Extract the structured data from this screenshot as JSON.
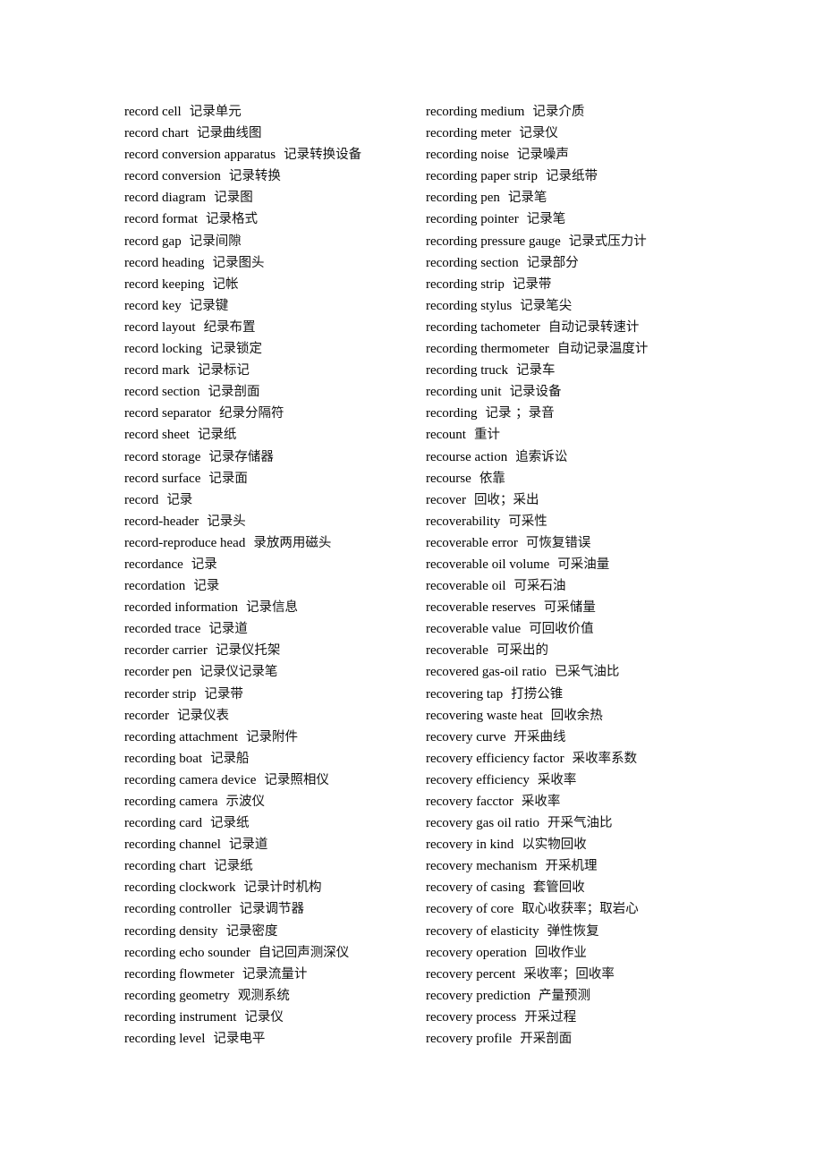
{
  "document": {
    "left_column": [
      {
        "en": "record cell",
        "zh": "记录单元"
      },
      {
        "en": "record chart",
        "zh": "记录曲线图"
      },
      {
        "en": "record conversion apparatus",
        "zh": "记录转换设备"
      },
      {
        "en": "record conversion",
        "zh": "记录转换"
      },
      {
        "en": "record diagram",
        "zh": "记录图"
      },
      {
        "en": "record format",
        "zh": "记录格式"
      },
      {
        "en": "record gap",
        "zh": "记录间隙"
      },
      {
        "en": "record heading",
        "zh": "记录图头"
      },
      {
        "en": "record keeping",
        "zh": "记帐"
      },
      {
        "en": "record key",
        "zh": "记录键"
      },
      {
        "en": "record layout",
        "zh": "纪录布置"
      },
      {
        "en": "record locking",
        "zh": "记录锁定"
      },
      {
        "en": "record mark",
        "zh": "记录标记"
      },
      {
        "en": "record section",
        "zh": "记录剖面"
      },
      {
        "en": "record separator",
        "zh": "纪录分隔符"
      },
      {
        "en": "record sheet",
        "zh": "记录纸"
      },
      {
        "en": "record storage",
        "zh": "记录存储器"
      },
      {
        "en": "record surface",
        "zh": "记录面"
      },
      {
        "en": "record",
        "zh": "记录"
      },
      {
        "en": "record-header",
        "zh": "记录头"
      },
      {
        "en": "record-reproduce head",
        "zh": "录放两用磁头"
      },
      {
        "en": "recordance",
        "zh": "记录"
      },
      {
        "en": "recordation",
        "zh": "记录"
      },
      {
        "en": "recorded information",
        "zh": "记录信息"
      },
      {
        "en": "recorded trace",
        "zh": "记录道"
      },
      {
        "en": "recorder carrier",
        "zh": "记录仪托架"
      },
      {
        "en": "recorder pen",
        "zh": "记录仪记录笔"
      },
      {
        "en": "recorder strip",
        "zh": "记录带"
      },
      {
        "en": "recorder",
        "zh": "记录仪表"
      },
      {
        "en": "recording attachment",
        "zh": "记录附件"
      },
      {
        "en": "recording boat",
        "zh": "记录船"
      },
      {
        "en": "recording camera device",
        "zh": "记录照相仪"
      },
      {
        "en": "recording camera",
        "zh": "示波仪"
      },
      {
        "en": "recording card",
        "zh": "记录纸"
      },
      {
        "en": "recording channel",
        "zh": "记录道"
      },
      {
        "en": "recording chart",
        "zh": "记录纸"
      },
      {
        "en": "recording clockwork",
        "zh": "记录计时机构"
      },
      {
        "en": "recording controller",
        "zh": "记录调节器"
      },
      {
        "en": "recording density",
        "zh": "记录密度"
      },
      {
        "en": "recording echo sounder",
        "zh": "自记回声测深仪"
      },
      {
        "en": "recording flowmeter",
        "zh": "记录流量计"
      },
      {
        "en": "recording geometry",
        "zh": "观测系统"
      },
      {
        "en": "recording instrument",
        "zh": "记录仪"
      },
      {
        "en": "recording level",
        "zh": "记录电平"
      }
    ],
    "right_column": [
      {
        "en": "recording medium",
        "zh": "记录介质"
      },
      {
        "en": "recording meter",
        "zh": "记录仪"
      },
      {
        "en": "recording noise",
        "zh": "记录噪声"
      },
      {
        "en": "recording paper strip",
        "zh": "记录纸带"
      },
      {
        "en": "recording pen",
        "zh": "记录笔"
      },
      {
        "en": "recording pointer",
        "zh": "记录笔"
      },
      {
        "en": "recording pressure gauge",
        "zh": "记录式压力计"
      },
      {
        "en": "recording section",
        "zh": "记录部分"
      },
      {
        "en": "recording strip",
        "zh": "记录带"
      },
      {
        "en": "recording stylus",
        "zh": "记录笔尖"
      },
      {
        "en": "recording tachometer",
        "zh": "自动记录转速计"
      },
      {
        "en": "recording thermometer",
        "zh": "自动记录温度计"
      },
      {
        "en": "recording truck",
        "zh": "记录车"
      },
      {
        "en": "recording unit",
        "zh": "记录设备"
      },
      {
        "en": "recording",
        "zh": "记录 ；录音"
      },
      {
        "en": "recount",
        "zh": "重计"
      },
      {
        "en": "recourse action",
        "zh": "追索诉讼"
      },
      {
        "en": "recourse",
        "zh": "依靠"
      },
      {
        "en": "recover",
        "zh": "回收；采出"
      },
      {
        "en": "recoverability",
        "zh": "可采性"
      },
      {
        "en": "recoverable error",
        "zh": "可恢复错误"
      },
      {
        "en": "recoverable oil volume",
        "zh": "可采油量"
      },
      {
        "en": "recoverable oil",
        "zh": "可采石油"
      },
      {
        "en": "recoverable reserves",
        "zh": "可采储量"
      },
      {
        "en": "recoverable value",
        "zh": "可回收价值"
      },
      {
        "en": "recoverable",
        "zh": "可采出的"
      },
      {
        "en": "recovered gas-oil ratio",
        "zh": "已采气油比"
      },
      {
        "en": "recovering tap",
        "zh": "打捞公锥"
      },
      {
        "en": "recovering waste heat",
        "zh": "回收余热"
      },
      {
        "en": "recovery curve",
        "zh": "开采曲线"
      },
      {
        "en": "recovery efficiency factor",
        "zh": "采收率系数"
      },
      {
        "en": "recovery efficiency",
        "zh": "采收率"
      },
      {
        "en": "recovery facctor",
        "zh": "采收率"
      },
      {
        "en": "recovery gas oil ratio",
        "zh": "开采气油比"
      },
      {
        "en": "recovery in kind",
        "zh": "以实物回收"
      },
      {
        "en": "recovery mechanism",
        "zh": "开采机理"
      },
      {
        "en": "recovery of casing",
        "zh": "套管回收"
      },
      {
        "en": "recovery of core",
        "zh": "取心收获率；取岩心"
      },
      {
        "en": "recovery of elasticity",
        "zh": "弹性恢复"
      },
      {
        "en": "recovery operation",
        "zh": "回收作业"
      },
      {
        "en": "recovery percent",
        "zh": "采收率；回收率"
      },
      {
        "en": "recovery prediction",
        "zh": "产量预测"
      },
      {
        "en": "recovery process",
        "zh": "开采过程"
      },
      {
        "en": "recovery profile",
        "zh": "开采剖面"
      }
    ]
  }
}
